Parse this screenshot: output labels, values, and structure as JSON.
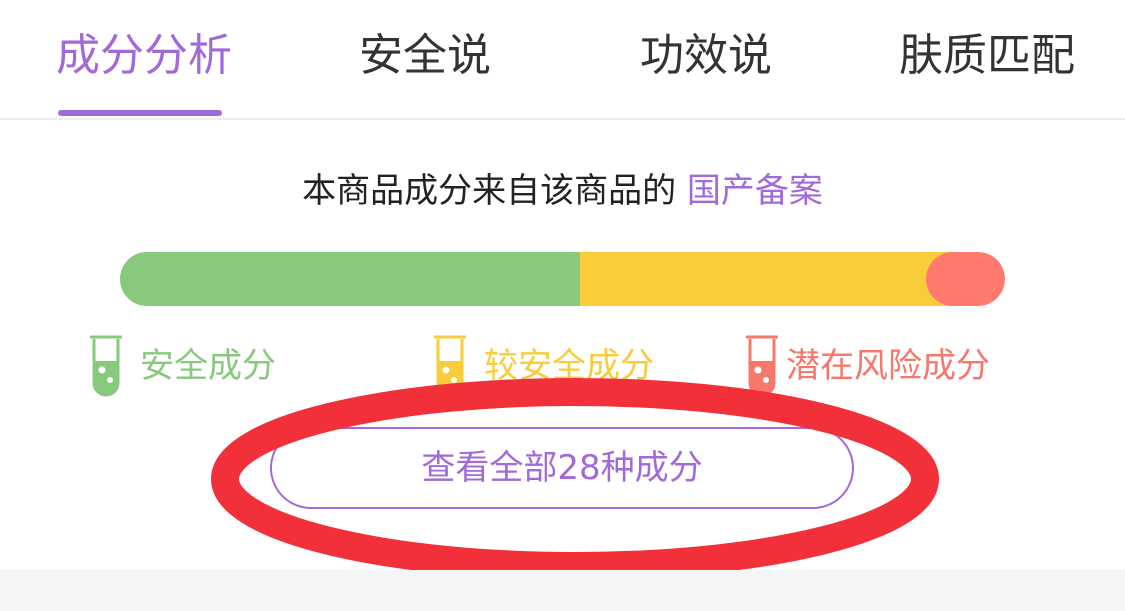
{
  "tabs": [
    {
      "label": "成分分析",
      "active": true
    },
    {
      "label": "安全说",
      "active": false
    },
    {
      "label": "功效说",
      "active": false
    },
    {
      "label": "肤质匹配",
      "active": false
    }
  ],
  "source": {
    "prefix": "本商品成分来自该商品的",
    "link": "国产备案"
  },
  "distribution": {
    "safe_fraction": 0.52,
    "moderate_fraction": 0.42,
    "risk_fraction": 0.06
  },
  "legend": [
    {
      "label": "安全成分",
      "color": "#88c97d",
      "icon": "test-tube-icon"
    },
    {
      "label": "较安全成分",
      "color": "#f8cc3a",
      "icon": "test-tube-icon"
    },
    {
      "label": "潜在风险成分",
      "color": "#f6786c",
      "icon": "test-tube-icon"
    }
  ],
  "cta": {
    "label": "查看全部28种成分"
  },
  "colors": {
    "accent": "#a26ad8",
    "safe": "#88c97d",
    "moderate": "#f8cc3a",
    "risk": "#ff7a6e",
    "annotation": "#f2303a"
  }
}
